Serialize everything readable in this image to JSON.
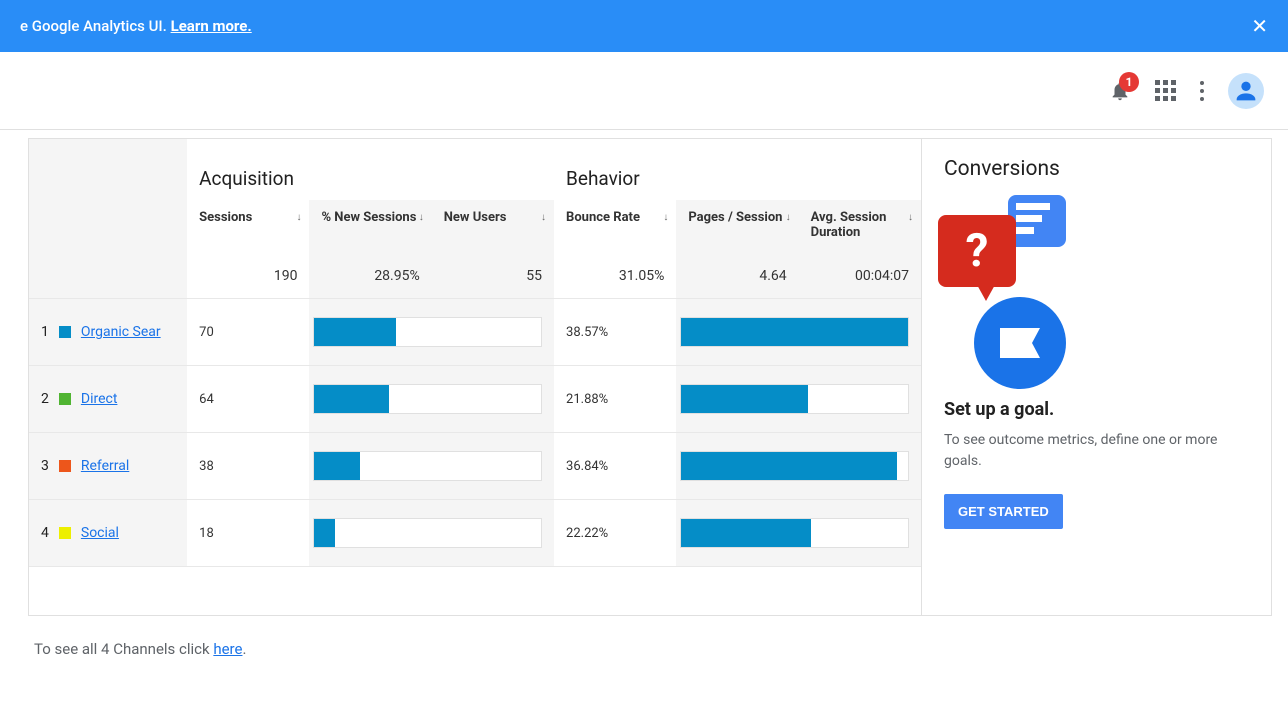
{
  "banner": {
    "text_prefix": "e Google Analytics UI. ",
    "learn_more": "Learn more."
  },
  "topbar": {
    "notification_count": "1"
  },
  "table": {
    "groups": {
      "acquisition": "Acquisition",
      "behavior": "Behavior"
    },
    "columns": {
      "sessions": "Sessions",
      "pct_new_sessions": "% New Sessions",
      "new_users": "New Users",
      "bounce_rate": "Bounce Rate",
      "pages_session": "Pages / Session",
      "avg_duration": "Avg. Session Duration"
    },
    "totals": {
      "sessions": "190",
      "pct_new_sessions": "28.95%",
      "new_users": "55",
      "bounce_rate": "31.05%",
      "pages_session": "4.64",
      "avg_duration": "00:04:07"
    },
    "rows": [
      {
        "idx": "1",
        "color": "#058dc7",
        "label": "Organic Sear",
        "sessions": "70",
        "bounce": "38.57%",
        "bar1": 36,
        "bar2": 100
      },
      {
        "idx": "2",
        "color": "#50b432",
        "label": "Direct",
        "sessions": "64",
        "bounce": "21.88%",
        "bar1": 33,
        "bar2": 56
      },
      {
        "idx": "3",
        "color": "#ed561b",
        "label": "Referral",
        "sessions": "38",
        "bounce": "36.84%",
        "bar1": 20,
        "bar2": 95
      },
      {
        "idx": "4",
        "color": "#edef00",
        "label": "Social",
        "sessions": "18",
        "bounce": "22.22%",
        "bar1": 9,
        "bar2": 57
      }
    ]
  },
  "side": {
    "title": "Conversions",
    "heading": "Set up a goal.",
    "text": "To see outcome metrics, define one or more goals.",
    "button": "GET STARTED"
  },
  "footer": {
    "prefix": "To see all 4 Channels click ",
    "link": "here",
    "suffix": "."
  }
}
